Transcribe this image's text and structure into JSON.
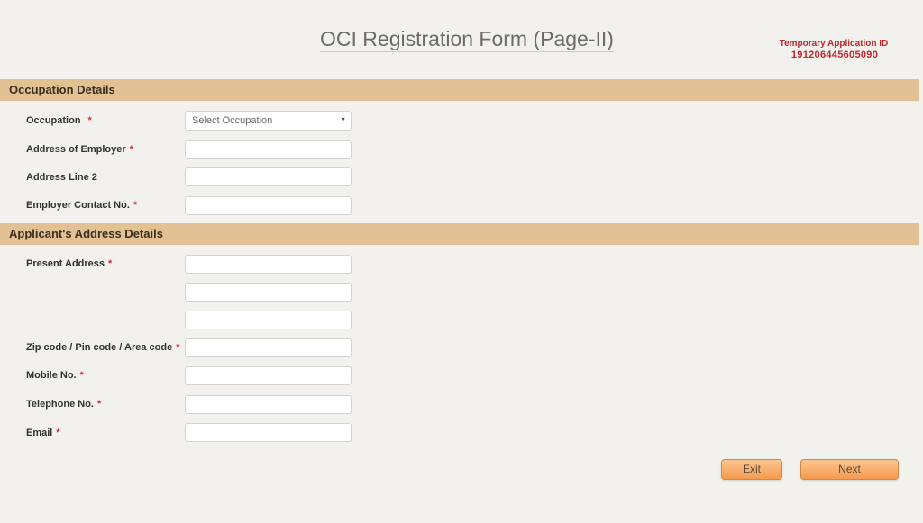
{
  "page": {
    "title": "OCI Registration Form (Page-II)",
    "temp_id_label": "Temporary Application ID",
    "temp_id_value": "191206445605090"
  },
  "occupation_section": {
    "header": "Occupation Details",
    "occupation_label": "Occupation",
    "occupation_selected": "Select Occupation",
    "employer_address_label": "Address of Employer",
    "address_line2_label": "Address Line 2",
    "employer_contact_label": "Employer Contact No."
  },
  "address_section": {
    "header": "Applicant's Address Details",
    "present_address_label": "Present Address",
    "zip_label": "Zip code / Pin code / Area code",
    "mobile_label": "Mobile No.",
    "telephone_label": "Telephone No.",
    "email_label": "Email"
  },
  "required_marker": "*",
  "icons": {
    "dropdown": "caret-down-icon"
  },
  "buttons": {
    "exit": "Exit",
    "next": "Next"
  },
  "colors": {
    "section_header": "#e2c194",
    "required": "#d0303a",
    "temp_id": "#c0282d",
    "button": "#f59b4e"
  }
}
